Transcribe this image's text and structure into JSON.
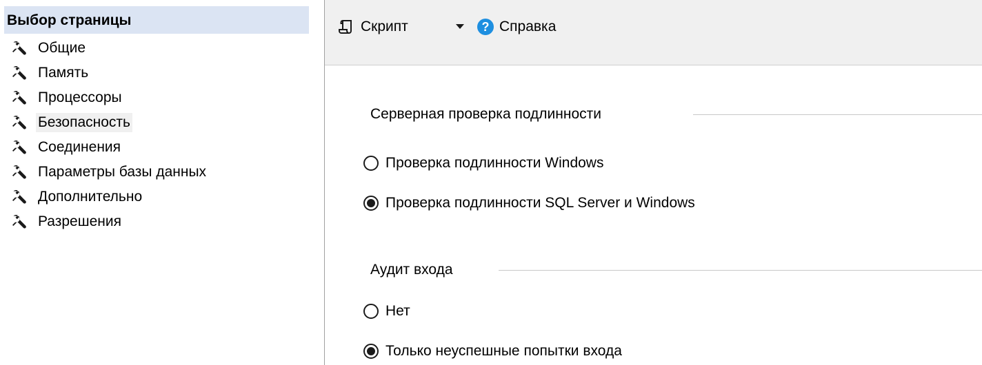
{
  "left": {
    "header": "Выбор страницы",
    "items": [
      {
        "label": "Общие"
      },
      {
        "label": "Память"
      },
      {
        "label": "Процессоры"
      },
      {
        "label": "Безопасность",
        "selected": true
      },
      {
        "label": "Соединения"
      },
      {
        "label": "Параметры базы данных"
      },
      {
        "label": "Дополнительно"
      },
      {
        "label": "Разрешения"
      }
    ]
  },
  "toolbar": {
    "script_label": "Скрипт",
    "help_label": "Справка",
    "help_glyph": "?"
  },
  "auth": {
    "title": "Серверная проверка подлинности",
    "options": [
      {
        "label": "Проверка подлинности Windows",
        "checked": false
      },
      {
        "label": "Проверка подлинности SQL Server и Windows",
        "checked": true
      }
    ]
  },
  "audit": {
    "title": "Аудит входа",
    "options": [
      {
        "label": "Нет",
        "checked": false
      },
      {
        "label": "Только неуспешные попытки входа",
        "checked": true
      }
    ]
  },
  "colors": {
    "header_bg": "#dbe4f3",
    "toolbar_bg": "#f0f0f0",
    "help_blue": "#1e8fe0"
  },
  "icons": {
    "nav_item": "wrench-icon",
    "script": "script-icon",
    "dropdown": "triangle-down-icon",
    "help": "question-circle-icon"
  }
}
